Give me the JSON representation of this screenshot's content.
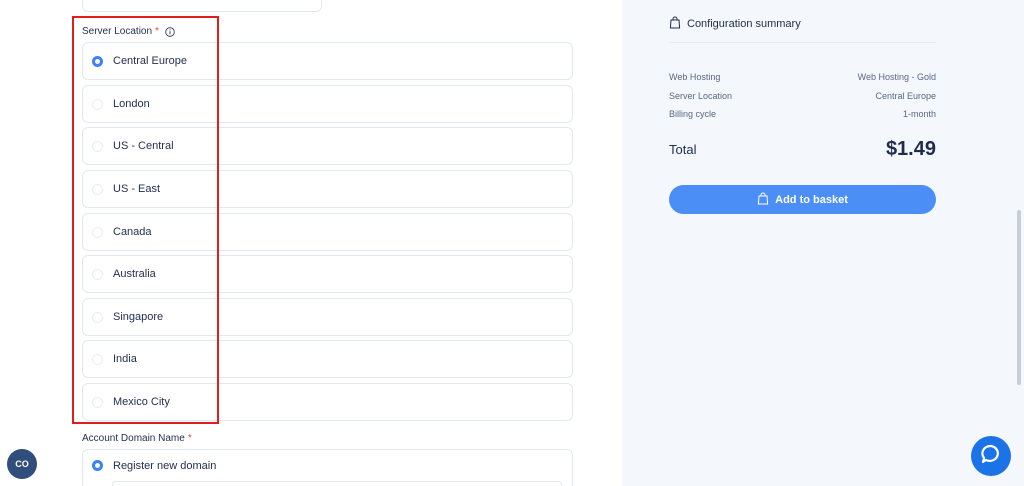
{
  "server_location": {
    "label": "Server Location",
    "required_mark": "*",
    "options": [
      {
        "label": "Central Europe",
        "selected": true
      },
      {
        "label": "London",
        "selected": false
      },
      {
        "label": "US - Central",
        "selected": false
      },
      {
        "label": "US - East",
        "selected": false
      },
      {
        "label": "Canada",
        "selected": false
      },
      {
        "label": "Australia",
        "selected": false
      },
      {
        "label": "Singapore",
        "selected": false
      },
      {
        "label": "India",
        "selected": false
      },
      {
        "label": "Mexico City",
        "selected": false
      }
    ]
  },
  "account_domain": {
    "label": "Account Domain Name",
    "required_mark": "*",
    "options": [
      {
        "label": "Register new domain",
        "selected": true
      }
    ]
  },
  "summary": {
    "title": "Configuration summary",
    "rows": [
      {
        "label": "Web Hosting",
        "value": "Web Hosting - Gold"
      },
      {
        "label": "Server Location",
        "value": "Central Europe"
      },
      {
        "label": "Billing cycle",
        "value": "1-month"
      }
    ],
    "total_label": "Total",
    "total_value": "$1.49",
    "button_label": "Add to basket"
  },
  "widgets": {
    "cookie_label": "CO"
  },
  "colors": {
    "accent": "#4b8ef5",
    "radio_checked": "#3b82f6",
    "highlight": "#e01e1e",
    "chat": "#1c73e8",
    "cookie": "#2f4e7c",
    "sidebar_bg": "#f4f7fb"
  },
  "icons": {
    "info": "info-icon",
    "bag": "shopping-bag-icon",
    "chat": "chat-bubble-icon"
  }
}
